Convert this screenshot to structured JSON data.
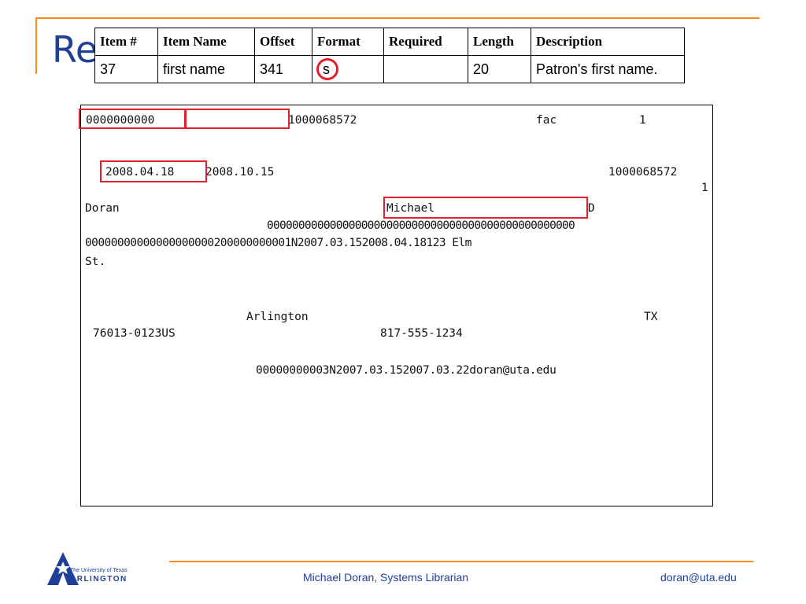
{
  "slide": {
    "title_partial": "Re"
  },
  "spec_table": {
    "headers": [
      "Item #",
      "Item Name",
      "Offset",
      "Format",
      "Required",
      "Length",
      "Description"
    ],
    "row": {
      "item_no": "37",
      "item_name": "first name",
      "offset": "341",
      "format": "s",
      "required": "",
      "length": "20",
      "description": "Patron's first name."
    }
  },
  "record": {
    "line1_a": "0000000000",
    "line1_b": "1000068572",
    "line1_c": "fac",
    "line1_d": "1",
    "line2_a": "2008.04.18",
    "line2_b": "2008.10.15",
    "line2_c": "1000068572",
    "line3": "1",
    "line4_a": "Doran",
    "line4_b": "Michael",
    "line4_c": "D",
    "line5": "0000000000000000000000000000000000000000000000000",
    "line6": "00000000000000000000200000000001N2007.03.152008.04.18123 Elm",
    "line7": "St.",
    "line8_a": "Arlington",
    "line8_b": "TX",
    "line9_a": "76013-0123US",
    "line9_b": "817-555-1234",
    "line10": "00000000003N2007.03.152007.03.22doran@uta.edu"
  },
  "footer": {
    "logo_line1": "The University of Texas",
    "logo_line2": "ARLINGTON",
    "center": "Michael Doran, Systems Librarian",
    "right": "doran@uta.edu"
  },
  "colors": {
    "accent_orange": "#ff8c1a",
    "highlight_red": "#e0202a",
    "brand_blue": "#1f3f99"
  }
}
